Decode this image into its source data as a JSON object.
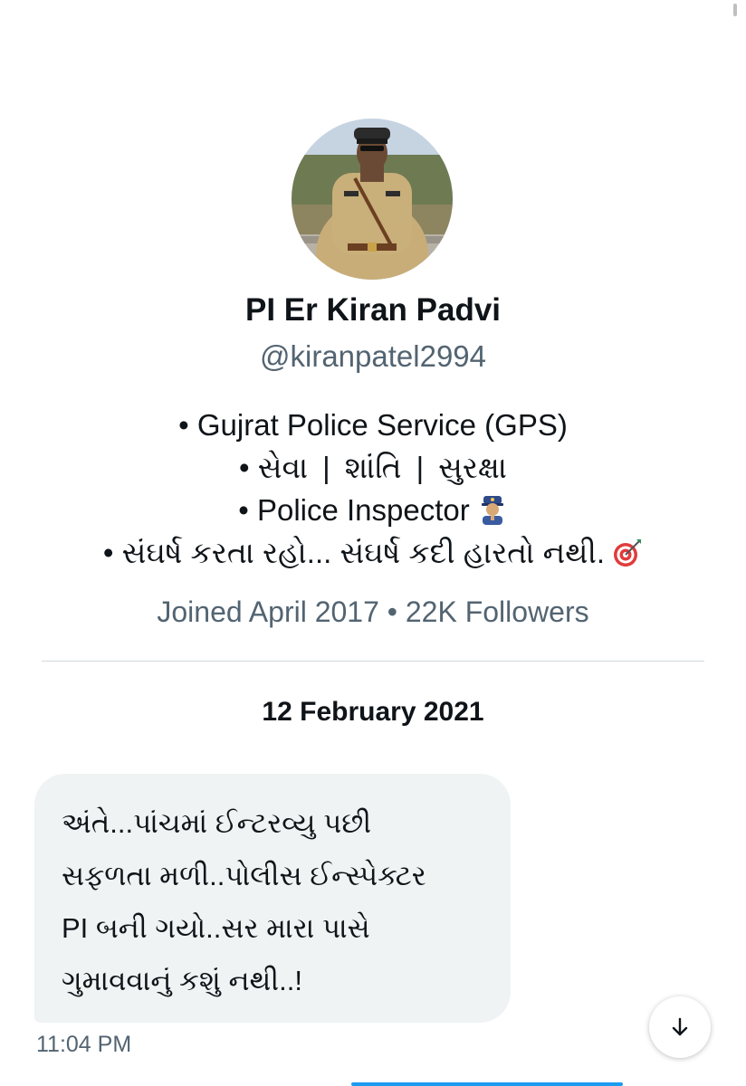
{
  "profile": {
    "name": "PI Er Kiran Padvi",
    "handle": "@kiranpatel2994",
    "bio": {
      "line1": "• Gujrat Police Service (GPS)",
      "line2_bullet": "• સેવા",
      "line2_sep1": "|",
      "line2_word2": "શાંતિ",
      "line2_sep2": "|",
      "line2_word3": "સુરક્ષા",
      "line3": "• Police Inspector",
      "line3_emoji": "police-officer-icon",
      "line4": "• સંઘર્ષ કરતા રહો... સંઘર્ષ કદી હારતો નથી.",
      "line4_emoji": "direct-hit-icon"
    },
    "meta": "Joined April 2017 • 22K Followers"
  },
  "conversation": {
    "date": "12 February 2021",
    "messages": [
      {
        "text": "અંતે...પાંચમાં ઈન્ટરવ્યુ પછી\nસફળતા મળી..પોલીસ ઈન્સ્પેક્ટર\nPI બની ગયો..સર મારા પાસે\nગુમાવવાનું કશું નથી..!",
        "time": "11:04 PM"
      }
    ]
  },
  "icons": {
    "scroll_down": "arrow-down-icon"
  },
  "colors": {
    "bubble": "#eff3f4",
    "secondary_text": "#536471",
    "divider": "#cfd9de"
  }
}
